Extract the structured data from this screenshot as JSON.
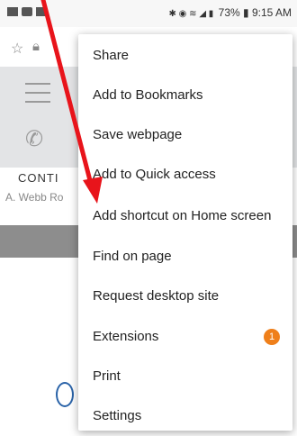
{
  "status_bar": {
    "battery": "73%",
    "time": "9:15 AM",
    "right_glyphs": "✱ ◉ ≋ ◢ ▮"
  },
  "page": {
    "contact_title": "CONTI",
    "contact_address": "A. Webb Ro"
  },
  "menu": {
    "items": [
      {
        "label": "Share"
      },
      {
        "label": "Add to Bookmarks"
      },
      {
        "label": "Save webpage"
      },
      {
        "label": "Add to Quick access"
      },
      {
        "label": "Add shortcut on Home screen"
      },
      {
        "label": "Find on page"
      },
      {
        "label": "Request desktop site"
      },
      {
        "label": "Extensions",
        "badge": "1"
      },
      {
        "label": "Print"
      },
      {
        "label": "Settings"
      }
    ]
  },
  "colors": {
    "annotation_arrow": "#e8141b",
    "badge": "#ef7f1a"
  },
  "icons": {
    "address_bar": [
      "star-icon",
      "lock-icon"
    ],
    "page": [
      "hamburger-icon",
      "phone-icon"
    ]
  }
}
